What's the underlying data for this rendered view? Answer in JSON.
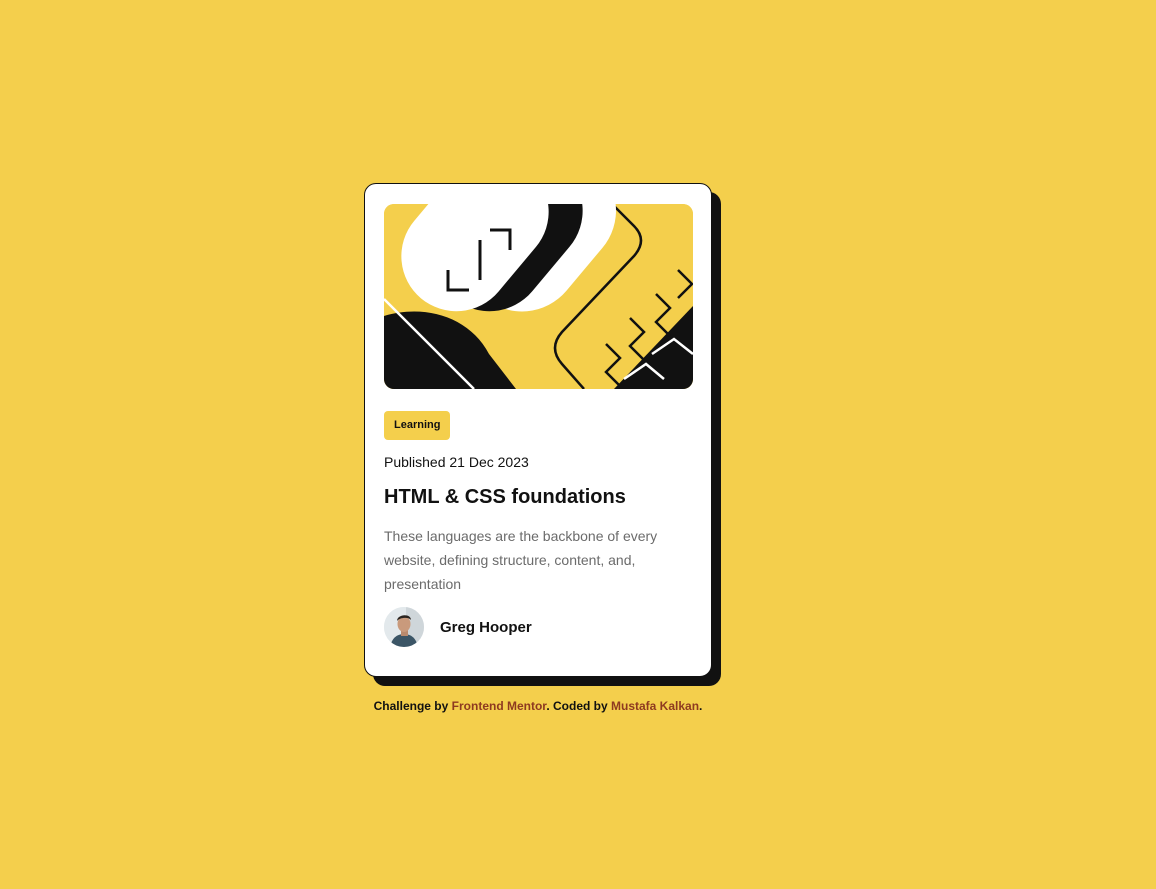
{
  "card": {
    "image_alt": "illustration-article",
    "tag": "Learning",
    "published": "Published 21 Dec 2023",
    "title": "HTML & CSS foundations",
    "description": "These languages are the backbone of every website, defining structure, content, and, presentation",
    "author": {
      "name": "Greg Hooper"
    }
  },
  "attribution": {
    "prefix": "Challenge by ",
    "link1": "Frontend Mentor",
    "middle": ". Coded by ",
    "link2": "Mustafa Kalkan",
    "suffix": "."
  },
  "colors": {
    "background": "#F4CF4C",
    "card": "#FFFFFF",
    "text": "#111111",
    "muted": "#6B6B6B",
    "link": "#8E3A20"
  }
}
